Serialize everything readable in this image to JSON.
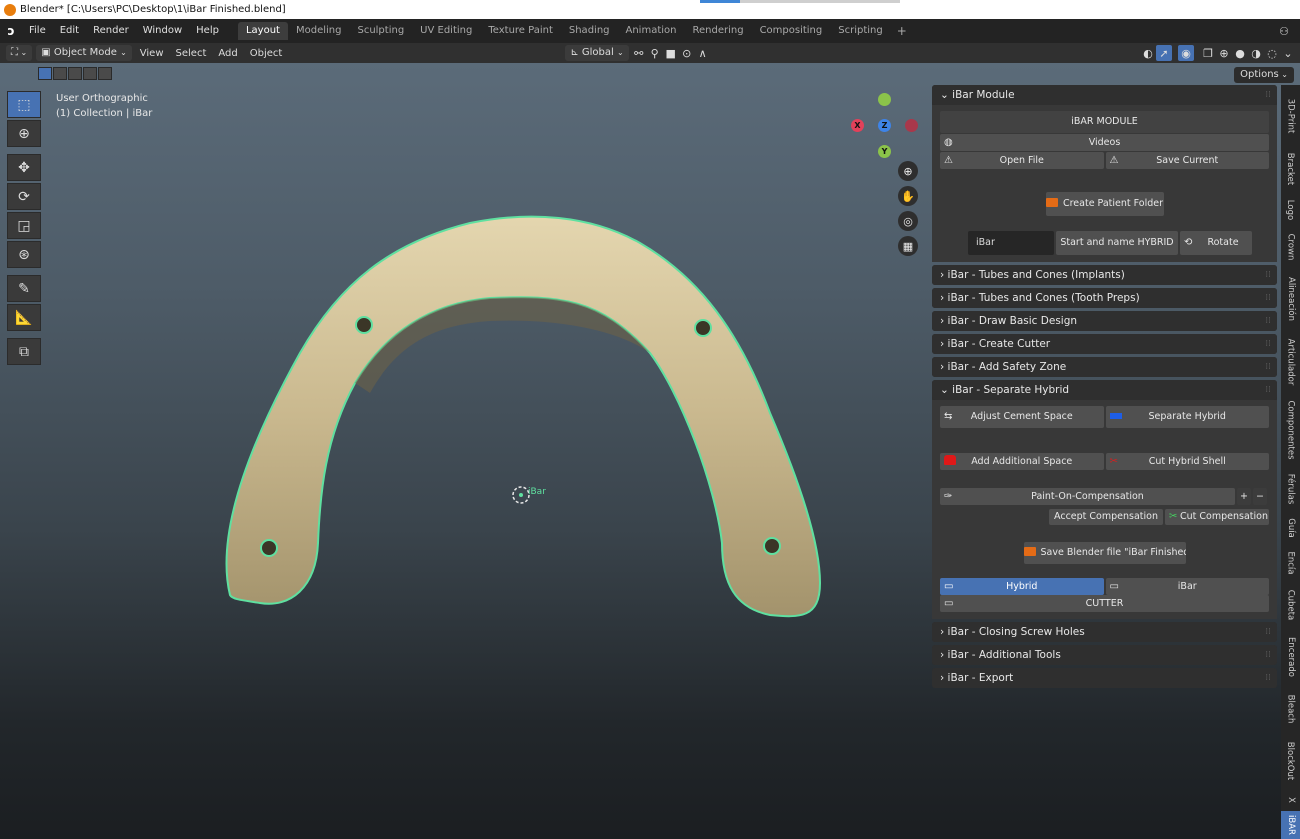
{
  "window": {
    "title": "Blender* [C:\\Users\\PC\\Desktop\\1\\iBar Finished.blend]"
  },
  "topbar": {
    "menus": [
      "File",
      "Edit",
      "Render",
      "Window",
      "Help"
    ],
    "workspaces": [
      "Layout",
      "Modeling",
      "Sculpting",
      "UV Editing",
      "Texture Paint",
      "Shading",
      "Animation",
      "Rendering",
      "Compositing",
      "Scripting"
    ],
    "active_workspace": "Layout"
  },
  "viewport_header": {
    "mode": "Object Mode",
    "menus": [
      "View",
      "Select",
      "Add",
      "Object"
    ],
    "orientation": "Global",
    "options_label": "Options"
  },
  "viewport": {
    "view_name": "User Orthographic",
    "collection": "(1) Collection | iBar",
    "object_label": "iBar",
    "model_color": "#d2c29a",
    "outline_color": "#5fe0a0"
  },
  "gizmo": {
    "x": "X",
    "y": "Y",
    "z": "Z"
  },
  "sidepanel": {
    "module_title": "iBar Module",
    "module_header": "iBAR MODULE",
    "videos": "Videos",
    "open_file": "Open File",
    "save_current": "Save Current",
    "create_patient_folder": "Create Patient Folder",
    "name_field": "iBar",
    "start_hybrid": "Start and name HYBRID",
    "rotate": "Rotate",
    "collapsed_1": [
      "iBar - Tubes and Cones (Implants)",
      "iBar - Tubes and Cones (Tooth Preps)",
      "iBar - Draw Basic Design",
      "iBar - Create Cutter",
      "iBar - Add Safety Zone"
    ],
    "separate_title": "iBar - Separate Hybrid",
    "adjust_cement": "Adjust Cement Space",
    "separate_hybrid": "Separate Hybrid",
    "add_additional": "Add Additional Space",
    "cut_hybrid_shell": "Cut Hybrid Shell",
    "paint_on": "Paint-On-Compensation",
    "plus": "+",
    "minus": "−",
    "accept_comp": "Accept Compensation",
    "cut_comp": "Cut Compensation",
    "save_blender": "Save Blender file \"iBar Finished\"",
    "hybrid": "Hybrid",
    "ibar": "iBar",
    "cutter": "CUTTER",
    "collapsed_2": [
      "iBar - Closing Screw Holes",
      "iBar - Additional Tools",
      "iBar - Export"
    ]
  },
  "tabs": [
    "3D-Print",
    "Bracket",
    "Logo",
    "Crown",
    "Alineación",
    "Articulador",
    "Componentes",
    "Férulas",
    "Guía",
    "Encía",
    "Cubeta",
    "Encerado",
    "Bleach",
    "BlockOut",
    "X",
    "iBAR"
  ],
  "colors": {
    "accent": "#4772b3",
    "panel": "#2f2f2f",
    "panel_body": "#383838"
  }
}
